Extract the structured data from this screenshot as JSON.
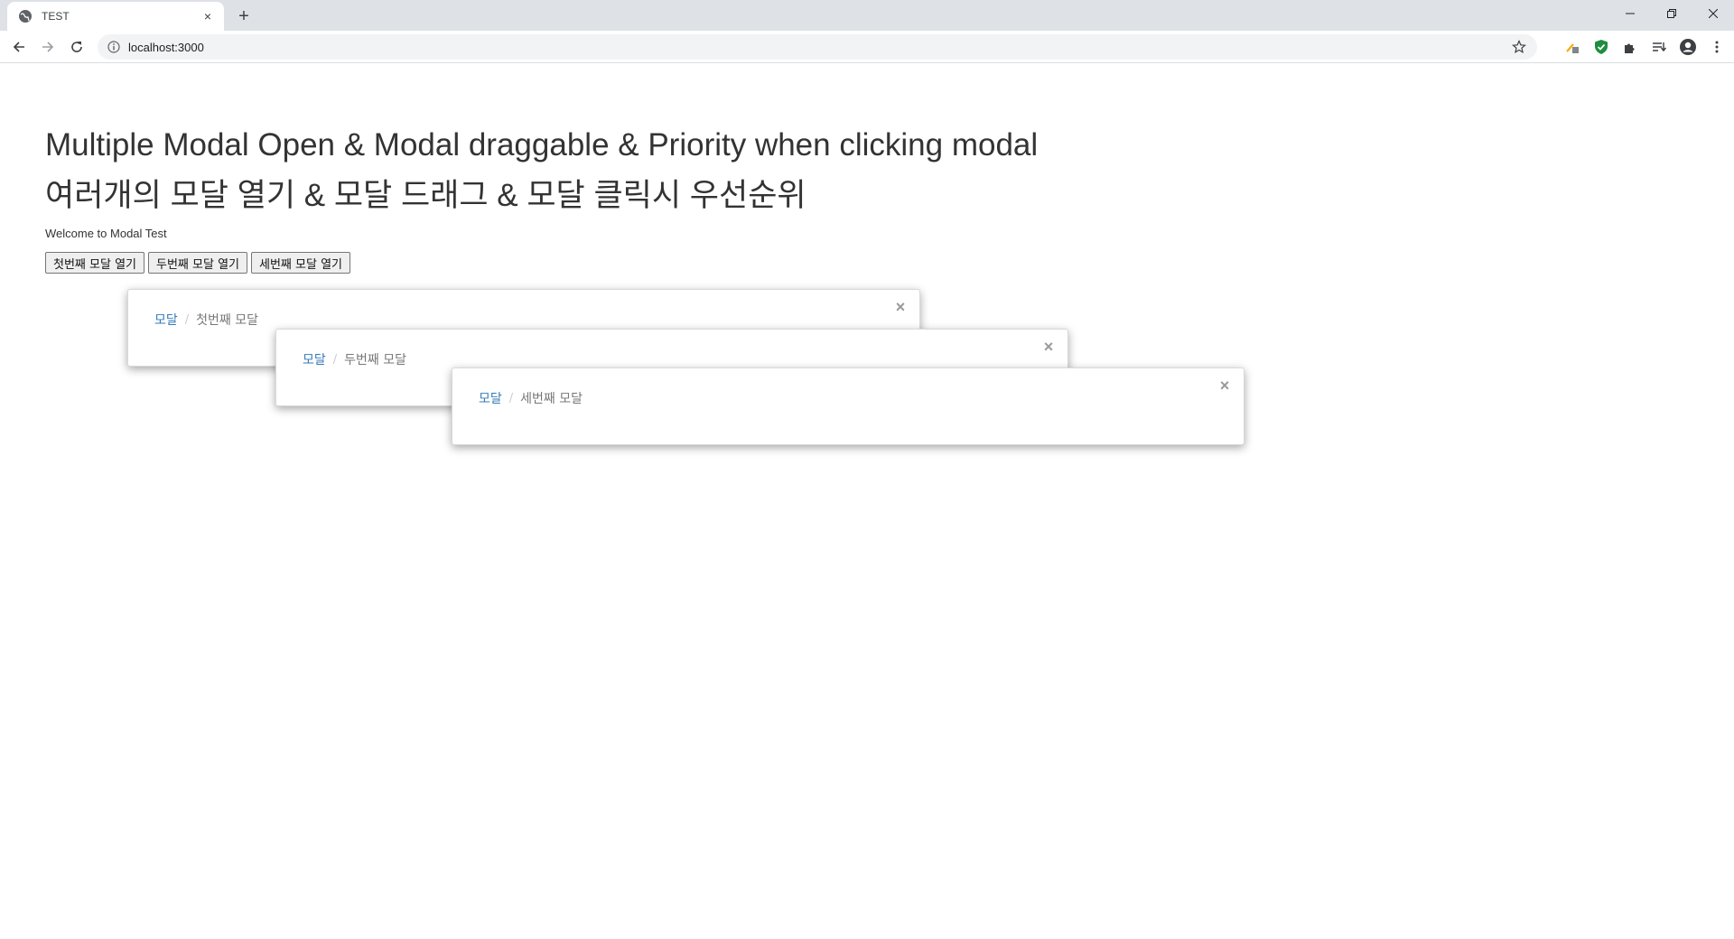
{
  "browser": {
    "tab_title": "TEST",
    "tab_close": "×",
    "new_tab": "+",
    "url": "localhost:3000",
    "window": {
      "minimize": "—",
      "restore": "❐",
      "close": "✕"
    }
  },
  "page": {
    "heading_en": "Multiple Modal Open & Modal draggable & Priority when clicking modal",
    "heading_ko": "여러개의 모달 열기 & 모달 드래그 & 모달 클릭시 우선순위",
    "welcome": "Welcome to Modal Test",
    "buttons": [
      "첫번째 모달 열기",
      "두번째 모달 열기",
      "세번째 모달 열기"
    ]
  },
  "modals": [
    {
      "crumb_link": "모달",
      "separator": "/",
      "crumb_current": "첫번째 모달",
      "close": "×"
    },
    {
      "crumb_link": "모달",
      "separator": "/",
      "crumb_current": "두번째 모달",
      "close": "×"
    },
    {
      "crumb_link": "모달",
      "separator": "/",
      "crumb_current": "세번째 모달",
      "close": "×"
    }
  ],
  "colors": {
    "link": "#337ab7",
    "heading": "#333333",
    "chrome_tabstrip": "#dee1e6",
    "omnibox": "#f1f3f4",
    "ext_green": "#1e8e3e"
  }
}
